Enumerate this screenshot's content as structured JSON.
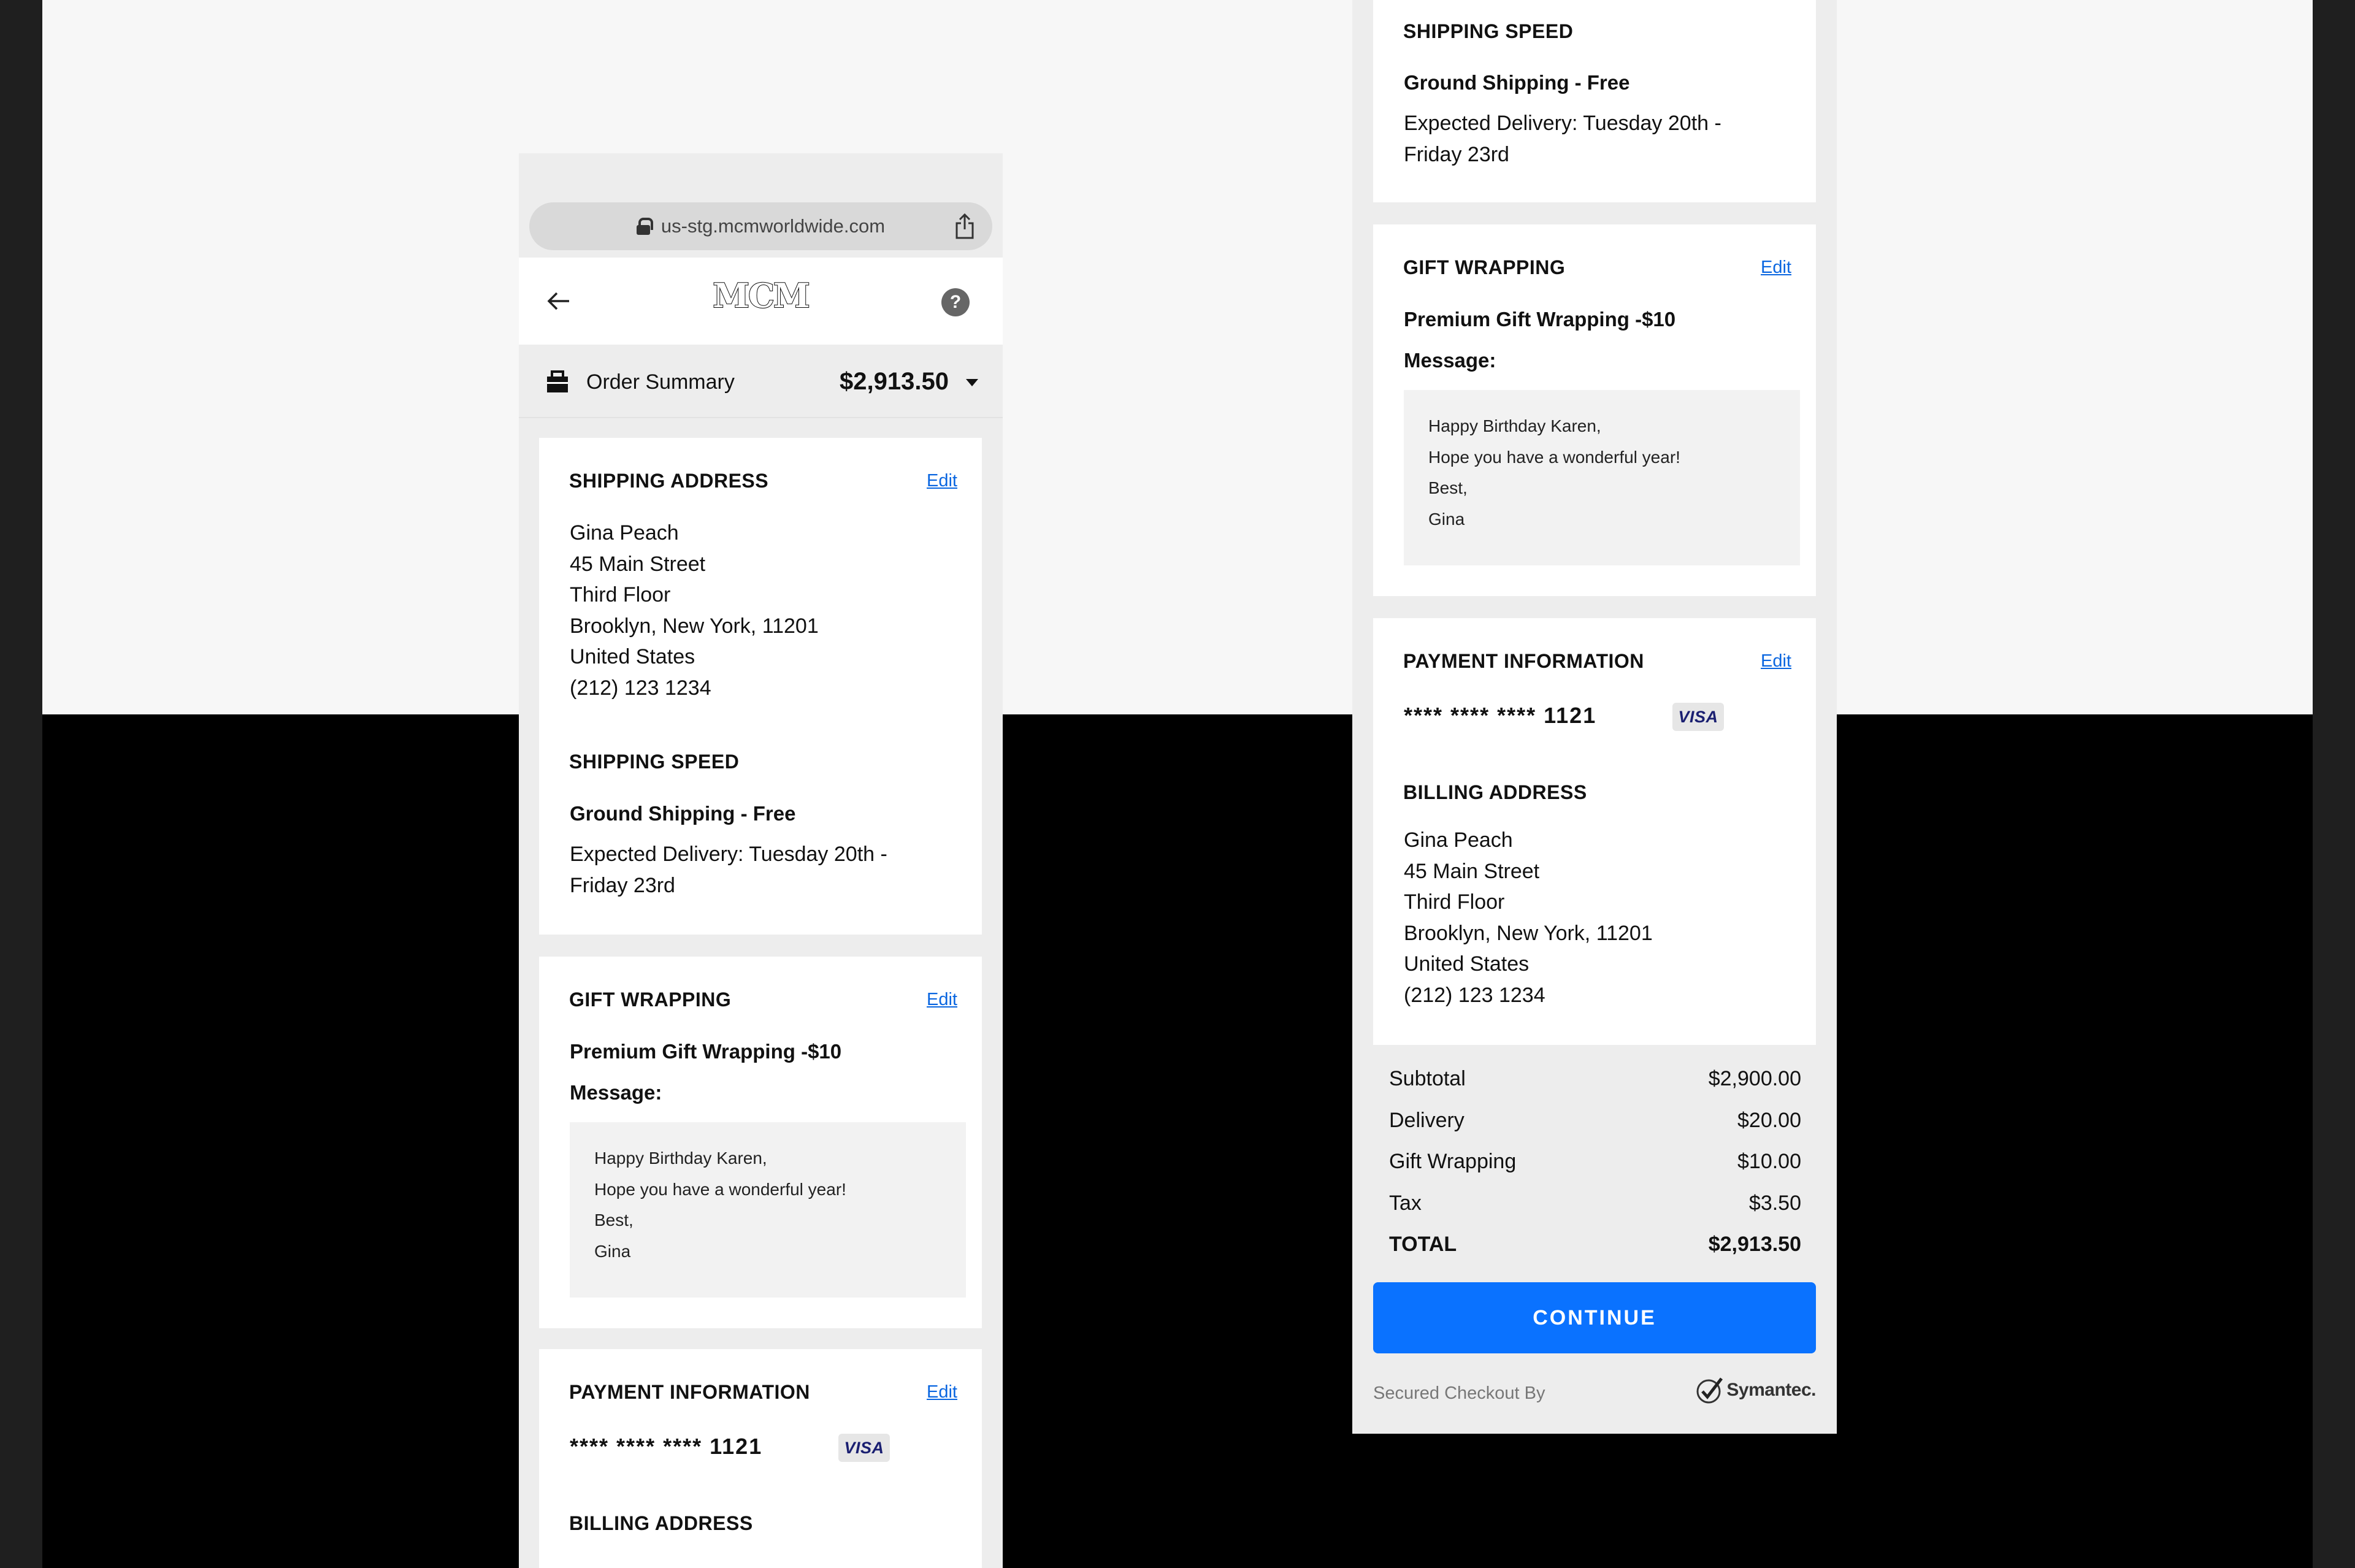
{
  "browser": {
    "url": "us-stg.mcmworldwide.com"
  },
  "header": {
    "logo": "MCM",
    "help": "?"
  },
  "order_summary": {
    "label": "Order Summary",
    "total": "$2,913.50"
  },
  "shipping_address": {
    "title": "SHIPPING ADDRESS",
    "edit": "Edit",
    "lines": [
      "Gina Peach",
      "45 Main Street",
      "Third Floor",
      "Brooklyn, New York, 11201",
      "United States",
      "(212) 123 1234"
    ]
  },
  "shipping_speed": {
    "title": "SHIPPING SPEED",
    "method": "Ground Shipping - Free",
    "expected_1": "Expected Delivery: Tuesday 20th -",
    "expected_2": "Friday 23rd"
  },
  "gift_wrapping": {
    "title": "GIFT WRAPPING",
    "edit": "Edit",
    "option": "Premium Gift Wrapping -$10",
    "message_label": "Message:",
    "message_lines": [
      "Happy Birthday Karen,",
      "Hope you have a wonderful year!",
      "Best,",
      "Gina"
    ]
  },
  "payment": {
    "title": "PAYMENT INFORMATION",
    "edit": "Edit",
    "card_number": "**** **** **** 1121",
    "card_brand": "VISA"
  },
  "billing_address": {
    "title": "BILLING ADDRESS",
    "lines": [
      "Gina Peach",
      "45 Main Street",
      "Third Floor",
      "Brooklyn, New York, 11201",
      "United States",
      "(212) 123 1234"
    ]
  },
  "totals": {
    "rows": [
      {
        "label": "Subtotal",
        "value": "$2,900.00"
      },
      {
        "label": "Delivery",
        "value": "$20.00"
      },
      {
        "label": "Gift Wrapping",
        "value": "$10.00"
      },
      {
        "label": "Tax",
        "value": "$3.50"
      },
      {
        "label": "TOTAL",
        "value": "$2,913.50"
      }
    ]
  },
  "continue_label": "CONTINUE",
  "secured_label": "Secured Checkout By",
  "symantec_label": "Symantec."
}
